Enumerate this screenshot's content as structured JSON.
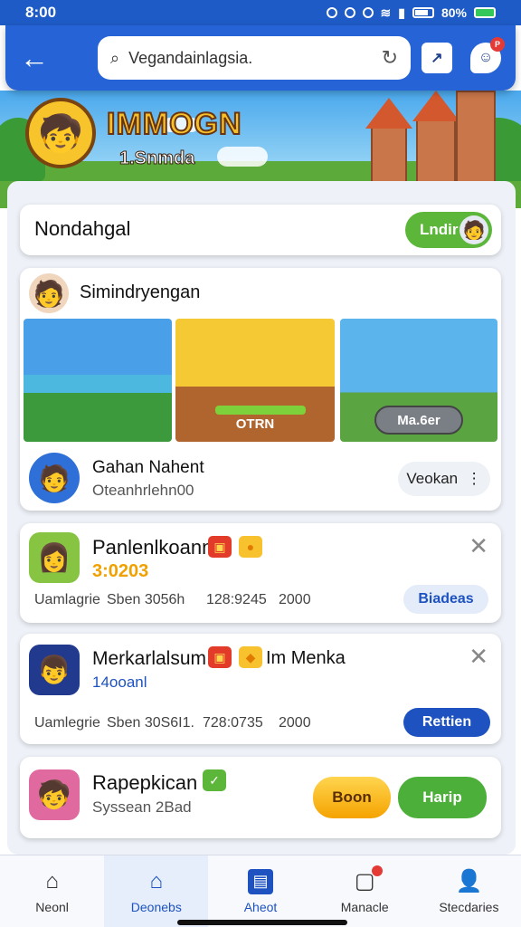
{
  "status": {
    "time": "8:00",
    "battery": "80%"
  },
  "appbar": {
    "search_value": "Vegandainlagsia.",
    "icon_chart": "chart-icon",
    "badge_count": "P"
  },
  "hero": {
    "title": "IMMOGN",
    "subtitle": "1.Snmda"
  },
  "section_header": {
    "label": "Nondahgal",
    "button": "Lndir"
  },
  "feature": {
    "title": "Simindryengan",
    "shot2_caption": "OTRN",
    "shot3_button": "Ma.6er",
    "author_name": "Gahan Nahent",
    "author_sub": "Oteanhrlehn00",
    "verify_button": "Veokan"
  },
  "items": [
    {
      "title": "Panlenlkoann",
      "sub": "3:0203",
      "meta1": "Uamlagrie",
      "meta2": "Sben 3056h",
      "meta3": "128:9245",
      "meta4": "2000",
      "action": "Biadeas"
    },
    {
      "title": "Merkarlalsum",
      "title_extra": "Im Menka",
      "sub": "14ooanl",
      "meta1": "Uamlegrie",
      "meta2": "Sben 30S6I1.",
      "meta3": "728:0735",
      "meta4": "2000",
      "action": "Rettien"
    },
    {
      "title": "Rapepkican",
      "sub": "Syssean 2Bad",
      "button1": "Boon",
      "button2": "Harip"
    }
  ],
  "nav": [
    {
      "label": "Neonl",
      "icon": "home-icon"
    },
    {
      "label": "Deonebs",
      "icon": "house-outline-icon"
    },
    {
      "label": "Aheot",
      "icon": "document-icon"
    },
    {
      "label": "Manacle",
      "icon": "notification-icon"
    },
    {
      "label": "Stecdaries",
      "icon": "profile-icon"
    }
  ]
}
